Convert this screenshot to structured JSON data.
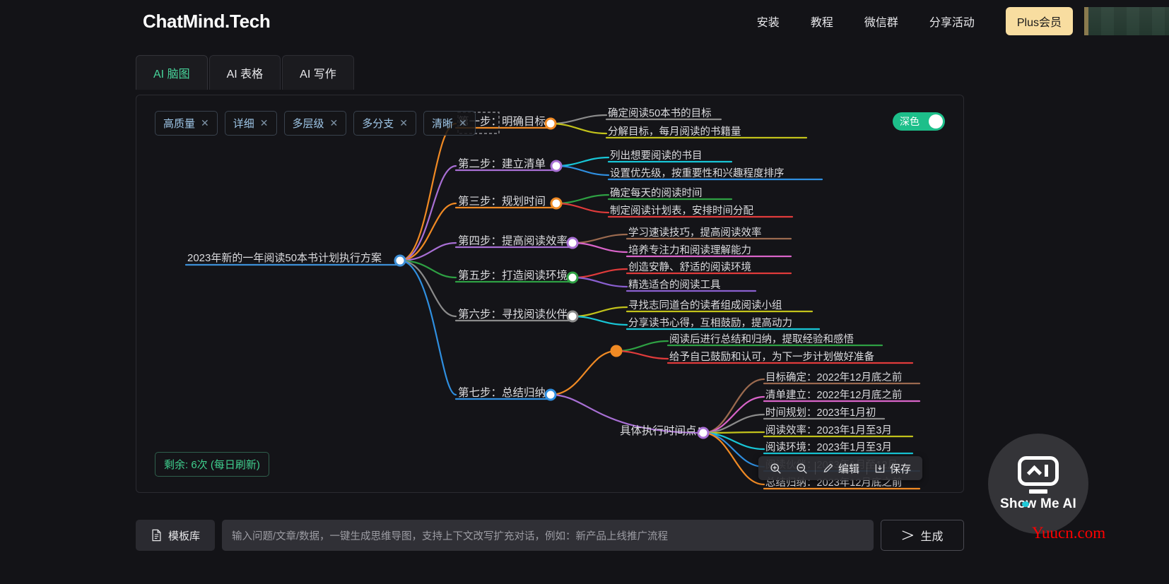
{
  "header": {
    "brand": "ChatMind.Tech",
    "nav": [
      {
        "label": "安装"
      },
      {
        "label": "教程"
      },
      {
        "label": "微信群"
      },
      {
        "label": "分享活动"
      }
    ],
    "plus_label": "Plus会员"
  },
  "tabs": [
    {
      "label": "AI 脑图",
      "active": true
    },
    {
      "label": "AI 表格",
      "active": false
    },
    {
      "label": "AI 写作",
      "active": false
    }
  ],
  "chips": [
    {
      "label": "高质量",
      "close": "✕"
    },
    {
      "label": "详细",
      "close": "✕"
    },
    {
      "label": "多层级",
      "close": "✕"
    },
    {
      "label": "多分支",
      "close": "✕"
    },
    {
      "label": "清晰",
      "close": "✕"
    }
  ],
  "dark_toggle": {
    "label": "深色",
    "on": true,
    "color": "#1dbf8a"
  },
  "remaining_badge": "剩余: 6次 (每日刷新)",
  "edit_toolbar": {
    "zoom_in": "zoom-in-icon",
    "zoom_out": "zoom-out-icon",
    "edit_label": "编辑",
    "save_label": "保存"
  },
  "bottom": {
    "template_label": "模板库",
    "prompt_placeholder": "输入问题/文章/数据，一键生成思维导图，支持上下文改写扩充对话，例如：新产品上线推广流程",
    "prompt_value": "",
    "generate_label": "生成"
  },
  "watermark": {
    "brand": "Show Me AI",
    "site": "Yuucn.com"
  },
  "mindmap": {
    "root": {
      "label": "2023年新的一年阅读50本书计划执行方案",
      "color": "#3d8fd6"
    },
    "branches": [
      {
        "label": "第一步：明确目标",
        "color": "#f08a24",
        "selected": true,
        "children": [
          {
            "label": "确定阅读50本书的目标",
            "color": "#8b8b8b"
          },
          {
            "label": "分解目标，每月阅读的书籍量",
            "color": "#c2c21b"
          }
        ]
      },
      {
        "label": "第二步：建立清单",
        "color": "#a86fd4",
        "children": [
          {
            "label": "列出想要阅读的书目",
            "color": "#18c6d6"
          },
          {
            "label": "设置优先级，按重要性和兴趣程度排序",
            "color": "#2f8fe0"
          }
        ]
      },
      {
        "label": "第三步：规划时间",
        "color": "#f08a24",
        "children": [
          {
            "label": "确定每天的阅读时间",
            "color": "#2ea043"
          },
          {
            "label": "制定阅读计划表，安排时间分配",
            "color": "#e03b3b"
          }
        ]
      },
      {
        "label": "第四步：提高阅读效率",
        "color": "#a86fd4",
        "children": [
          {
            "label": "学习速读技巧，提高阅读效率",
            "color": "#9b6a4f"
          },
          {
            "label": "培养专注力和阅读理解能力",
            "color": "#d964c9"
          }
        ]
      },
      {
        "label": "第五步：打造阅读环境",
        "color": "#2ea043",
        "children": [
          {
            "label": "创造安静、舒适的阅读环境",
            "color": "#e03b3b"
          },
          {
            "label": "精选适合的阅读工具",
            "color": "#8a5fd0"
          }
        ]
      },
      {
        "label": "第六步：寻找阅读伙伴",
        "color": "#8b8b8b",
        "children": [
          {
            "label": "寻找志同道合的读者组成阅读小组",
            "color": "#c2c21b"
          },
          {
            "label": "分享读书心得，互相鼓励，提高动力",
            "color": "#18c6d6"
          }
        ]
      },
      {
        "label": "第七步：总结归纳",
        "color": "#2f8fe0",
        "children": [
          {
            "label": "",
            "color": "#f08a24",
            "hub": true,
            "children": [
              {
                "label": "阅读后进行总结和归纳，提取经验和感悟",
                "color": "#2ea043"
              },
              {
                "label": "给予自己鼓励和认可，为下一步计划做好准备",
                "color": "#e03b3b"
              }
            ]
          },
          {
            "label": "具体执行时间点：",
            "color": "#a86fd4",
            "children": [
              {
                "label": "目标确定：2022年12月底之前",
                "color": "#9b6a4f"
              },
              {
                "label": "清单建立：2022年12月底之前",
                "color": "#d964c9"
              },
              {
                "label": "时间规划：2023年1月初",
                "color": "#8b8b8b"
              },
              {
                "label": "阅读效率：2023年1月至3月",
                "color": "#c2c21b"
              },
              {
                "label": "阅读环境：2023年1月至3月",
                "color": "#18c6d6"
              },
              {
                "label": "阅读伙伴：2023年1月至12月",
                "color": "#2f8fe0"
              },
              {
                "label": "总结归纳：2023年12月底之前",
                "color": "#f08a24"
              }
            ]
          }
        ]
      }
    ]
  }
}
